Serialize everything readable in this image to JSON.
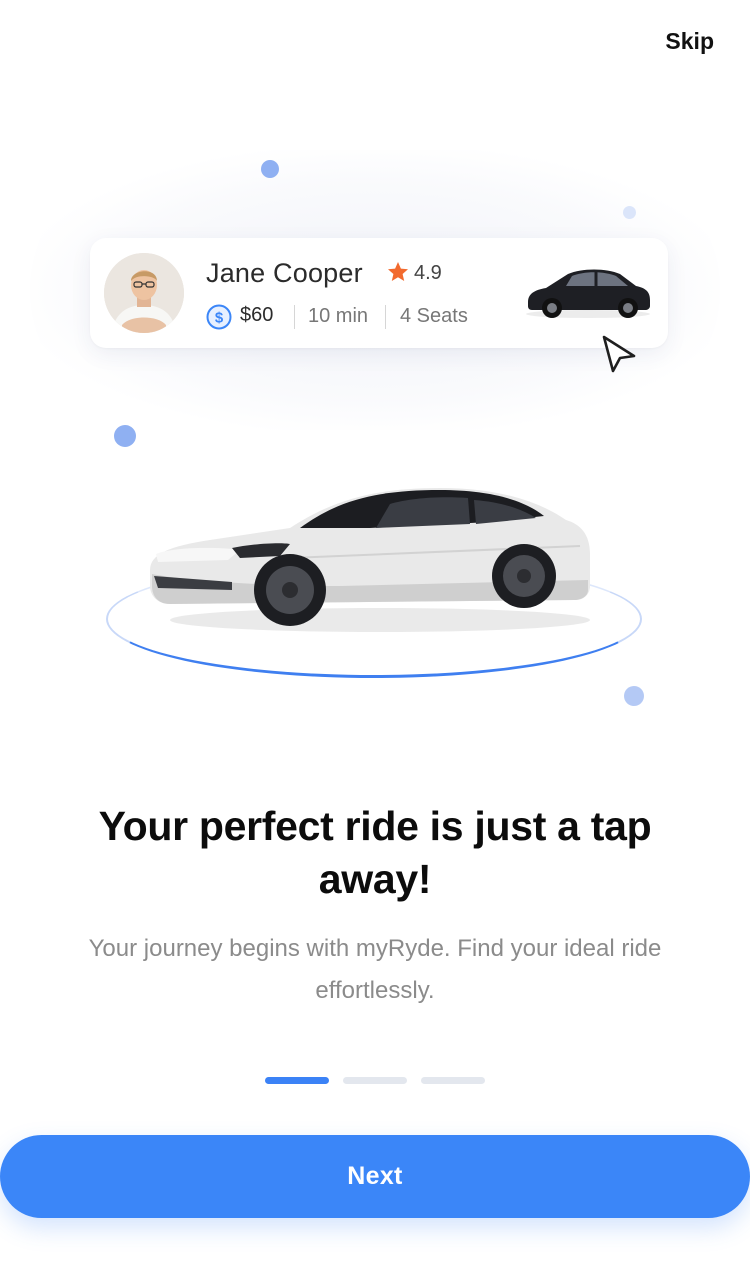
{
  "header": {
    "skip_label": "Skip"
  },
  "driver_card": {
    "name": "Jane Cooper",
    "rating": "4.9",
    "price": "$60",
    "duration": "10 min",
    "seats": "4 Seats",
    "icons": {
      "rating": "star-icon",
      "price": "dollar-coin-icon",
      "pointer": "cursor-arrow-icon"
    }
  },
  "onboarding": {
    "headline": "Your perfect ride is just a tap away!",
    "description": "Your journey begins with myRyde. Find your ideal ride effortlessly.",
    "pager": {
      "total": 3,
      "active_index": 0
    }
  },
  "actions": {
    "next_label": "Next"
  },
  "colors": {
    "accent": "#3B86F8",
    "dot": "#8FB0F2",
    "star": "#F26A2E",
    "pager_inactive": "#E3E7EE"
  }
}
